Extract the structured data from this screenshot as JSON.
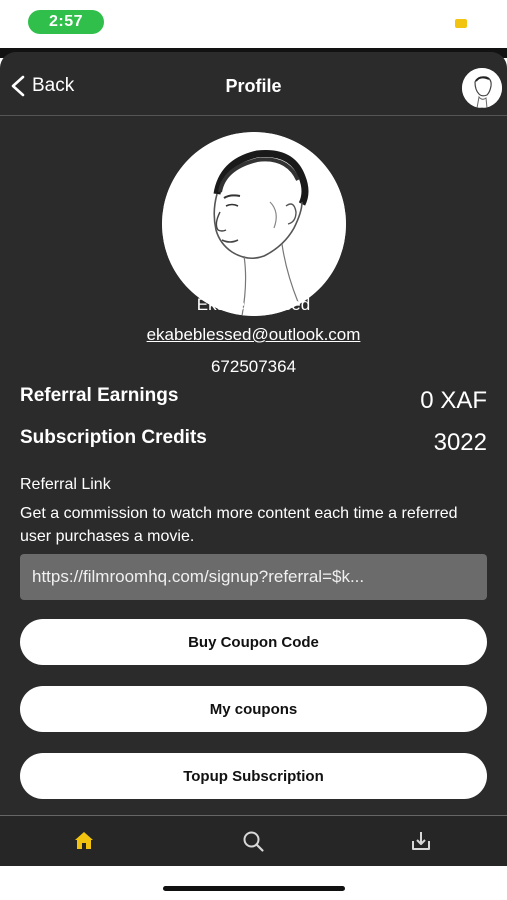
{
  "status_bar": {
    "time": "2:57"
  },
  "nav": {
    "back_label": "Back",
    "title": "Profile"
  },
  "profile": {
    "name": "Ekabe Blessed",
    "email": "ekabeblessed@outlook.com",
    "phone": "672507364"
  },
  "stats": [
    {
      "label": "Referral Earnings",
      "value": "0 XAF"
    },
    {
      "label": "Subscription Credits",
      "value": "3022"
    }
  ],
  "referral": {
    "title": "Referral Link",
    "description": "Get a commission to watch more content each time a referred user purchases a movie.",
    "link": "https://filmroomhq.com/signup?referral=$k..."
  },
  "buttons": {
    "buy_coupon": "Buy Coupon Code",
    "my_coupons": "My coupons",
    "topup": "Topup Subscription"
  },
  "tabs": [
    {
      "icon": "home-icon",
      "active": true
    },
    {
      "icon": "search-icon",
      "active": false
    },
    {
      "icon": "download-icon",
      "active": false
    }
  ],
  "colors": {
    "accent": "#f2c40f",
    "background": "#2b2b2b",
    "status_pill": "#2fbf4a"
  }
}
